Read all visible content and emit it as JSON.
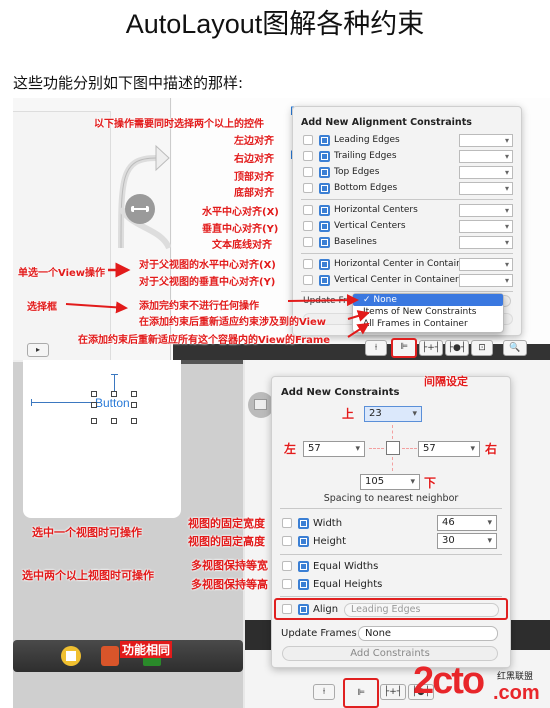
{
  "header": {
    "title": "AutoLayout图解各种约束",
    "intro": "这些功能分别如下图中描述的那样:"
  },
  "top_shot": {
    "button_labels": [
      "Bu",
      "Bu"
    ],
    "panel": {
      "title": "Add New Alignment Constraints",
      "group1": [
        {
          "label": "Leading Edges",
          "icon": "leading-edges-icon",
          "value": ""
        },
        {
          "label": "Trailing Edges",
          "icon": "trailing-edges-icon",
          "value": ""
        },
        {
          "label": "Top Edges",
          "icon": "top-edges-icon",
          "value": ""
        },
        {
          "label": "Bottom Edges",
          "icon": "bottom-edges-icon",
          "value": ""
        }
      ],
      "group2": [
        {
          "label": "Horizontal Centers",
          "icon": "horizontal-centers-icon",
          "value": ""
        },
        {
          "label": "Vertical Centers",
          "icon": "vertical-centers-icon",
          "value": ""
        },
        {
          "label": "Baselines",
          "icon": "baselines-icon",
          "value": ""
        }
      ],
      "group3": [
        {
          "label": "Horizontal Center in Container",
          "icon": "horizontal-center-container-icon",
          "value": ""
        },
        {
          "label": "Vertical Center in Container",
          "icon": "vertical-center-container-icon",
          "value": ""
        }
      ],
      "update_frames_label": "Update Frames",
      "menu": {
        "options": [
          "None",
          "Items of New Constraints",
          "All Frames in Container"
        ],
        "selected": "None",
        "checkmark": "✓"
      }
    },
    "toolbar": [
      "⍿",
      "⊫",
      "├+┤",
      "├●┤",
      "⊡",
      "🔍"
    ],
    "annotations": {
      "multi_select": "以下操作需要同时选择两个以上的控件",
      "leading": "左边对齐",
      "trailing": "右边对齐",
      "top": "顶部对齐",
      "bottom": "底部对齐",
      "hcenter": "水平中心对齐(X)",
      "vcenter": "垂直中心对齐(Y)",
      "baseline": "文本底线对齐",
      "single_view": "单选一个View操作",
      "hcenter_container": "对于父视图的水平中心对齐(X)",
      "vcenter_container": "对于父视图的垂直中心对齐(Y)",
      "select_box": "选择框",
      "none_desc": "添加完约束不进行任何操作",
      "items_desc": "在添加约束后重新适应约束涉及到的View",
      "all_desc": "在添加约束后重新适应所有这个容器内的View的Frame"
    }
  },
  "bottom_shot": {
    "canvas_button": "Button",
    "panel": {
      "title": "Add New Constraints",
      "spacing": {
        "top": "23",
        "left": "57",
        "right": "57",
        "bottom": "105"
      },
      "spacing_caption": "Spacing to nearest neighbor",
      "width": {
        "label": "Width",
        "value": "46"
      },
      "height": {
        "label": "Height",
        "value": "30"
      },
      "equal_widths": "Equal Widths",
      "equal_heights": "Equal Heights",
      "align": {
        "label": "Align",
        "value": "Leading Edges"
      },
      "update_frames_label": "Update Frames",
      "update_frames_value": "None",
      "add_button": "Add Constraints"
    },
    "annotations": {
      "spacing_setting": "间隔设定",
      "top": "上",
      "left": "左",
      "right": "右",
      "bottom": "下",
      "single_select": "选中一个视图时可操作",
      "fixed_width": "视图的固定宽度",
      "fixed_height": "视图的固定高度",
      "multi_select": "选中两个以上视图时可操作",
      "equal_width": "多视图保持等宽",
      "equal_height": "多视图保持等高",
      "same_function": "功能相同"
    },
    "toolbar": [
      "⍿",
      "⊫",
      "├+┤",
      "├●┤"
    ]
  },
  "watermark": {
    "logo": "2cto",
    "suffix": ".com",
    "tag": "红黑联盟"
  },
  "colors": {
    "annotation_red": "#e21b1b",
    "accent_blue": "#3a78e0",
    "button_blue": "#2a7bd8"
  }
}
